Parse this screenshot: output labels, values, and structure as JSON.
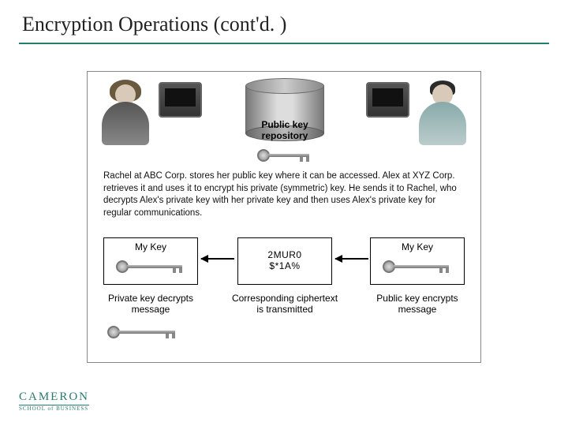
{
  "title": "Encryption Operations (cont'd. )",
  "figure": {
    "repo_label": "Public key repository",
    "description": "Rachel at ABC Corp. stores her public key where it can be accessed. Alex at XYZ Corp. retrieves it and uses it to encrypt his private (symmetric) key. He sends it to Rachel, who decrypts Alex's private key with her private key and then uses Alex's private key for regular communications.",
    "left_box_label": "My Key",
    "right_box_label": "My Key",
    "cipher_line1": "2MUR0",
    "cipher_line2": "$*1A%",
    "caption_left": "Private key decrypts message",
    "caption_mid": "Corresponding ciphertext is transmitted",
    "caption_right": "Public key encrypts message"
  },
  "logo": {
    "main": "CAMERON",
    "sub": "SCHOOL of BUSINESS"
  }
}
